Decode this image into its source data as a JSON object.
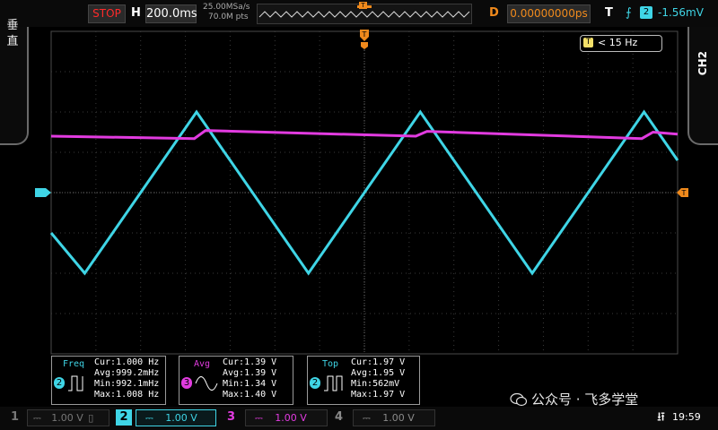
{
  "topbar": {
    "run_state": "STOP",
    "h_label": "H",
    "timebase": "200.0ms",
    "sample_rate": "25.00MSa/s",
    "memory_depth": "70.0M pts",
    "d_label": "D",
    "delay": "0.00000000ps",
    "t_label": "T",
    "trigger_edge_icon": "rising-edge-icon",
    "trigger_channel": "2",
    "trigger_level": "-1.56mV"
  },
  "side": {
    "left_tab": "垂直",
    "right_tab": "CH2"
  },
  "plot": {
    "bandwidth_badge_icon": "T",
    "bandwidth_badge": "< 15 Hz",
    "trigger_marker": "T"
  },
  "colors": {
    "ch1": "#f3e06a",
    "ch2": "#3fd5e6",
    "ch3": "#e23be0",
    "ch4": "#8a8a8a",
    "trigger": "#f08a1c",
    "grid": "#3a3a3a"
  },
  "chart_data": {
    "type": "line",
    "x_unit": "s",
    "xlim": [
      -1.4,
      1.4
    ],
    "ylim": [
      -4,
      4
    ],
    "series": [
      {
        "channel": "2",
        "color": "#3fd5e6",
        "x": [
          -1.4,
          -1.25,
          -0.75,
          -0.25,
          0.25,
          0.75,
          1.25,
          1.4
        ],
        "y": [
          -1.0,
          -2.0,
          2.0,
          -2.0,
          2.0,
          -2.0,
          2.0,
          0.8
        ]
      },
      {
        "channel": "3",
        "color": "#e23be0",
        "x": [
          -1.4,
          -0.76,
          -0.71,
          0.23,
          0.28,
          1.24,
          1.29,
          1.4
        ],
        "y": [
          1.4,
          1.34,
          1.54,
          1.4,
          1.52,
          1.34,
          1.5,
          1.45
        ]
      }
    ]
  },
  "measurements": [
    {
      "title": "Freq",
      "channel": "2",
      "icon": "frequency-pulse-icon",
      "cur": "Cur:1.000 Hz",
      "avg": "Avg:999.2mHz",
      "min": "Min:992.1mHz",
      "max": "Max:1.008 Hz"
    },
    {
      "title": "Avg",
      "channel": "3",
      "icon": "average-sine-icon",
      "cur": "Cur:1.39 V",
      "avg": "Avg:1.39 V",
      "min": "Min:1.34 V",
      "max": "Max:1.40 V"
    },
    {
      "title": "Top",
      "channel": "2",
      "icon": "top-pulse-icon",
      "cur": "Cur:1.97 V",
      "avg": "Avg:1.95 V",
      "min": "Min:562mV",
      "max": "Max:1.97 V"
    }
  ],
  "channels": [
    {
      "num": "1",
      "coupling_icon": "dc-coupling-icon",
      "scale": "1.00 V",
      "active": false
    },
    {
      "num": "2",
      "coupling_icon": "dc-coupling-icon",
      "scale": "1.00 V",
      "active": true
    },
    {
      "num": "3",
      "coupling_icon": "dc-coupling-icon",
      "scale": "1.00 V",
      "active": false
    },
    {
      "num": "4",
      "coupling_icon": "dc-coupling-icon",
      "scale": "1.00 V",
      "active": false
    }
  ],
  "watermark": "公众号 · 飞多学堂",
  "status": {
    "usb_icon": "usb-icon",
    "clock": "19:59"
  }
}
